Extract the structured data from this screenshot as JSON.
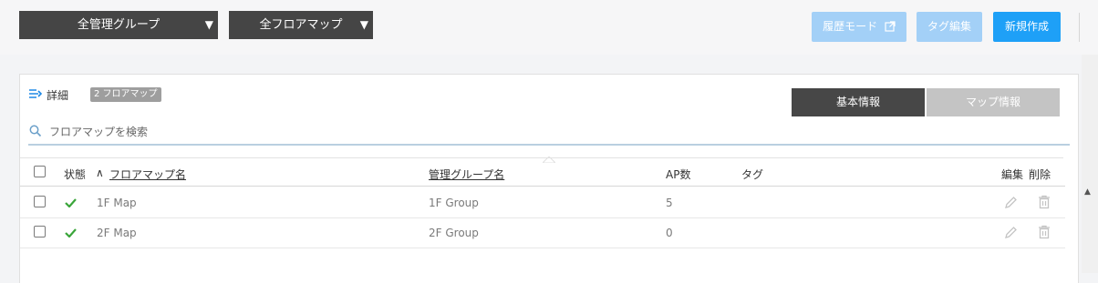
{
  "toolbar": {
    "group_select": "全管理グループ",
    "floormap_select": "全フロアマップ",
    "history_mode": "履歴モード",
    "tag_edit": "タグ編集",
    "new_create": "新規作成"
  },
  "panel": {
    "detail_label": "詳細",
    "floormap_count": "2 フロアマップ",
    "tabs": {
      "basic": "基本情報",
      "map": "マップ情報"
    },
    "search_placeholder": "フロアマップを検索"
  },
  "table": {
    "headers": {
      "status": "状態",
      "sort_indicator": "∧",
      "floormap_name": "フロアマップ名",
      "group_name": "管理グループ名",
      "ap_count": "AP数",
      "tag": "タグ",
      "edit": "編集",
      "delete": "削除"
    },
    "rows": [
      {
        "name": "1F Map",
        "group": "1F Group",
        "ap": "5",
        "tag": ""
      },
      {
        "name": "2F Map",
        "group": "2F Group",
        "ap": "0",
        "tag": ""
      }
    ]
  },
  "colors": {
    "primary": "#1ea0f7",
    "primary_disabled": "#a3d0f7",
    "dark": "#454545",
    "status_ok": "#3aa53a"
  }
}
